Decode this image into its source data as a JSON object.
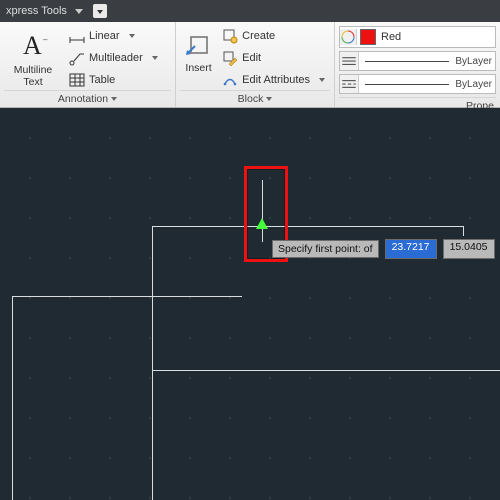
{
  "titlebar": {
    "tab": "xpress Tools"
  },
  "ribbon": {
    "annotation": {
      "title": "Annotation",
      "multiline_text": "Multiline Text",
      "linear": "Linear",
      "multileader": "Multileader",
      "table": "Table"
    },
    "block": {
      "title": "Block",
      "insert": "Insert",
      "create": "Create",
      "edit": "Edit",
      "edit_attributes": "Edit Attributes"
    },
    "properties": {
      "title": "Prope",
      "color": "Red",
      "layer1": "ByLayer",
      "layer2": "ByLayer"
    }
  },
  "canvas": {
    "prompt": "Specify first point: of",
    "coord_x": "23.7217",
    "coord_y": "15.0405"
  }
}
